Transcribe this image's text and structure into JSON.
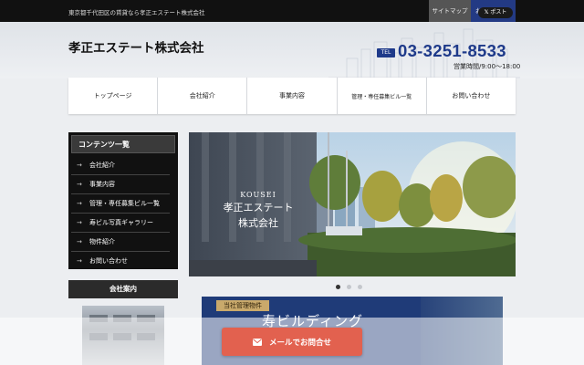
{
  "topbar": {
    "tagline": "東京都千代田区の賃貸なら孝正エステート株式会社",
    "sitemap": "サイトマップ",
    "contact": "お問い合わせ"
  },
  "header": {
    "company_name": "孝正エステート株式会社",
    "post_label": "ポスト",
    "tel_badge": "TEL",
    "tel_number": "03-3251-8533",
    "hours": "営業時間/9:00～18:00"
  },
  "nav": [
    {
      "label": "トップページ"
    },
    {
      "label": "会社紹介"
    },
    {
      "label": "事業内容"
    },
    {
      "label": "管理・専任募集ビル一覧"
    },
    {
      "label": "お問い合わせ"
    }
  ],
  "sidebar": {
    "title": "コンテンツ一覧",
    "items": [
      {
        "label": "会社紹介"
      },
      {
        "label": "事業内容"
      },
      {
        "label": "管理・専任募集ビル一覧"
      },
      {
        "label": "寿ビル写真ギャラリー"
      },
      {
        "label": "物件紹介"
      },
      {
        "label": "お問い合わせ"
      }
    ],
    "about_title": "会社案内"
  },
  "slider": {
    "en": "KOUSEI",
    "jp_line1": "孝正エステート",
    "jp_line2": "株式会社",
    "active_slide": 1,
    "slide_count": 3
  },
  "banner": {
    "tag": "当社管理物件",
    "name": "寿ビルディング"
  },
  "float": {
    "mail_button": "メールでお問合せ"
  },
  "colors": {
    "accent_blue": "#1e3a8a",
    "mail_button": "#e2614f",
    "banner_bg": "#1f3b78"
  }
}
